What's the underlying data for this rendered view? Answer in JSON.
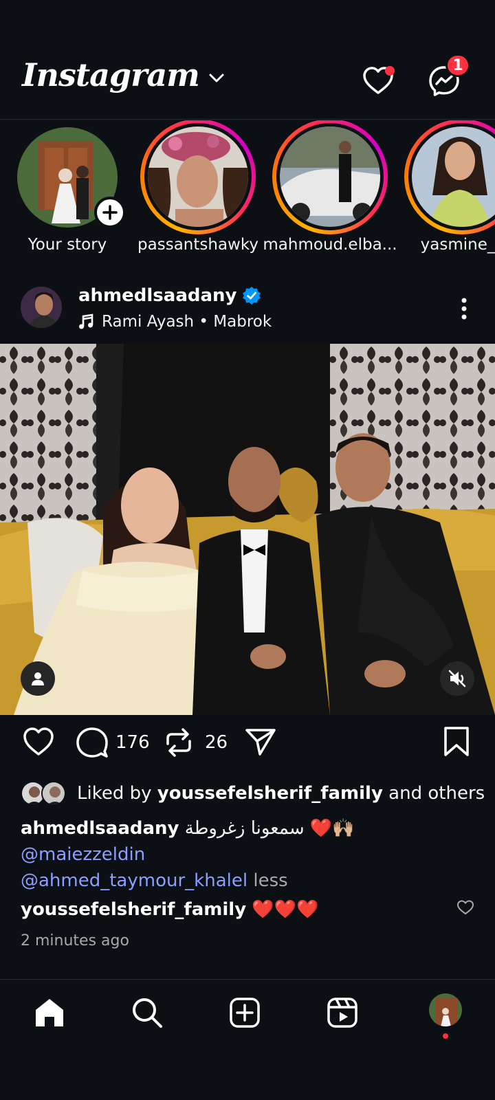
{
  "header": {
    "logo_text": "Instagram",
    "messages_badge": "1"
  },
  "stories": [
    {
      "username": "Your story",
      "has_ring": false
    },
    {
      "username": "passantshawky",
      "has_ring": true
    },
    {
      "username": "mahmoud.elba...",
      "has_ring": true
    },
    {
      "username": "yasmine_s",
      "has_ring": true
    }
  ],
  "post": {
    "username": "ahmedlsaadany",
    "music": "Rami Ayash • Mabrok",
    "comments_count": "176",
    "reposts_count": "26",
    "liked_by_prefix": "Liked by ",
    "liked_by_user": "youssefelsherif_family",
    "liked_by_suffix": " and others",
    "caption_user": "ahmedlsaadany",
    "caption_text": "سمعونا زغروطة ❤️🙌🏼",
    "mention_1": "@maiezzeldin",
    "mention_2": "@ahmed_taymour_khalel",
    "less_label": " less",
    "comment_user": "youssefelsherif_family",
    "comment_text": "❤️❤️❤️",
    "time_ago": "2 minutes ago"
  },
  "colors": {
    "background": "#0c0f14",
    "accent_red": "#ff3040",
    "mention_blue": "#8c9eff",
    "verified_blue": "#0095f6"
  },
  "icons": [
    "chevron-down-icon",
    "heart-icon",
    "messenger-icon",
    "plus-icon",
    "verified-icon",
    "music-note-icon",
    "more-vertical-icon",
    "person-tag-icon",
    "mute-icon",
    "comment-icon",
    "repost-icon",
    "share-icon",
    "bookmark-icon",
    "home-icon",
    "search-icon",
    "create-icon",
    "reels-icon"
  ]
}
